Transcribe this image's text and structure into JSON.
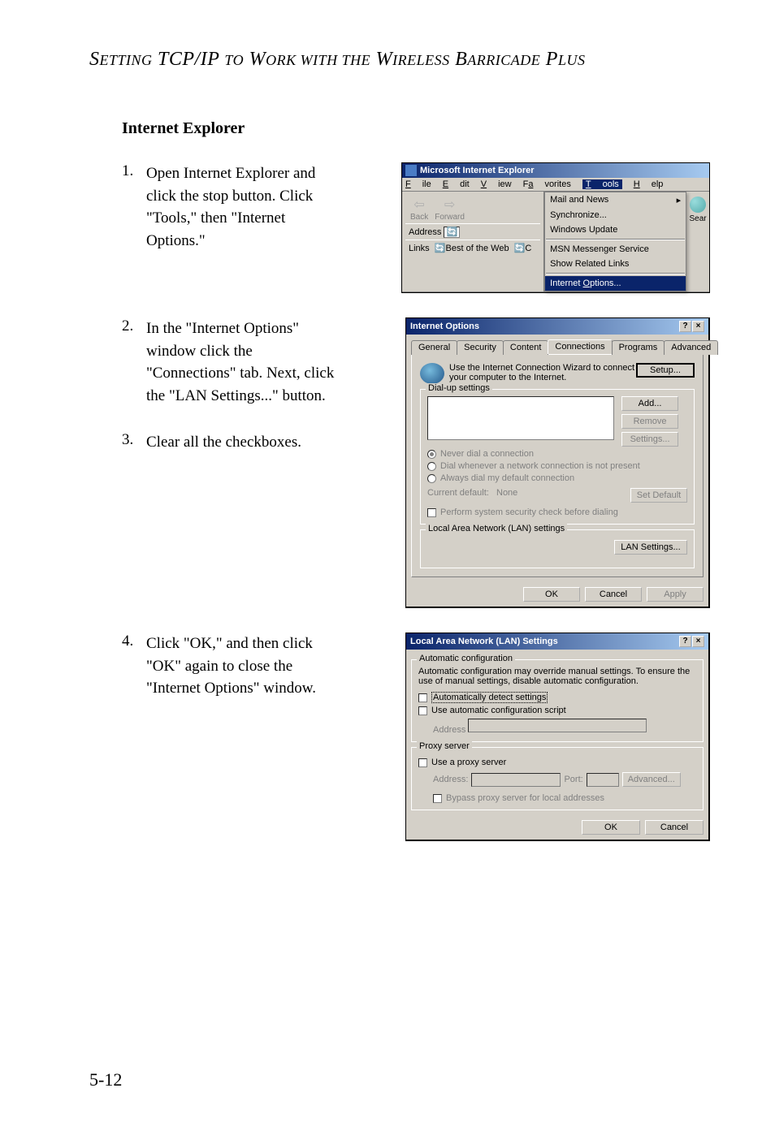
{
  "heading": "SETTING TCP/IP TO WORK WITH THE WIRELESS BARRICADE PLUS",
  "section_title": "Internet Explorer",
  "steps": {
    "s1_num": "1.",
    "s1_text": "Open Internet Explorer and click the stop button. Click \"Tools,\" then \"Internet Options.\"",
    "s2_num": "2.",
    "s2_text": "In the \"Internet Options\" window click the \"Connections\" tab. Next, click the \"LAN Settings...\" button.",
    "s3_num": "3.",
    "s3_text": "Clear all the checkboxes.",
    "s4_num": "4.",
    "s4_text": "Click \"OK,\" and then click \"OK\" again to close the \"Internet Options\" window."
  },
  "page_number": "5-12",
  "ie": {
    "title": "Microsoft Internet Explorer",
    "menu": {
      "file": "File",
      "edit": "Edit",
      "view": "View",
      "favorites": "Favorites",
      "tools": "Tools",
      "help": "Help"
    },
    "nav": {
      "back": "Back",
      "forward": "Forward"
    },
    "address_label": "Address",
    "links_label": "Links",
    "links_best": "Best of the Web",
    "search": "Sear",
    "dropdown": {
      "mail": "Mail and News",
      "sync": "Synchronize...",
      "winupdate": "Windows Update",
      "msn": "MSN Messenger Service",
      "related": "Show Related Links",
      "inetopt": "Internet Options..."
    }
  },
  "opt": {
    "title": "Internet Options",
    "tabs": {
      "general": "General",
      "security": "Security",
      "content": "Content",
      "connections": "Connections",
      "programs": "Programs",
      "advanced": "Advanced"
    },
    "wizard_text": "Use the Internet Connection Wizard to connect your computer to the Internet.",
    "setup": "Setup...",
    "dialup_label": "Dial-up settings",
    "add": "Add...",
    "remove": "Remove",
    "settings": "Settings...",
    "r1": "Never dial a connection",
    "r2": "Dial whenever a network connection is not present",
    "r3": "Always dial my default connection",
    "current": "Current default:",
    "none": "None",
    "setdefault": "Set Default",
    "perform": "Perform system security check before dialing",
    "lan_label": "Local Area Network (LAN) settings",
    "lan_btn": "LAN Settings...",
    "ok": "OK",
    "cancel": "Cancel",
    "apply": "Apply"
  },
  "lan": {
    "title": "Local Area Network (LAN) Settings",
    "auto_label": "Automatic configuration",
    "auto_text": "Automatic configuration may override manual settings. To ensure the use of manual settings, disable automatic configuration.",
    "auto_detect": "Automatically detect settings",
    "auto_script": "Use automatic configuration script",
    "address": "Address",
    "proxy_label": "Proxy server",
    "use_proxy": "Use a proxy server",
    "port": "Port:",
    "advanced": "Advanced...",
    "bypass": "Bypass proxy server for local addresses",
    "ok": "OK",
    "cancel": "Cancel"
  }
}
